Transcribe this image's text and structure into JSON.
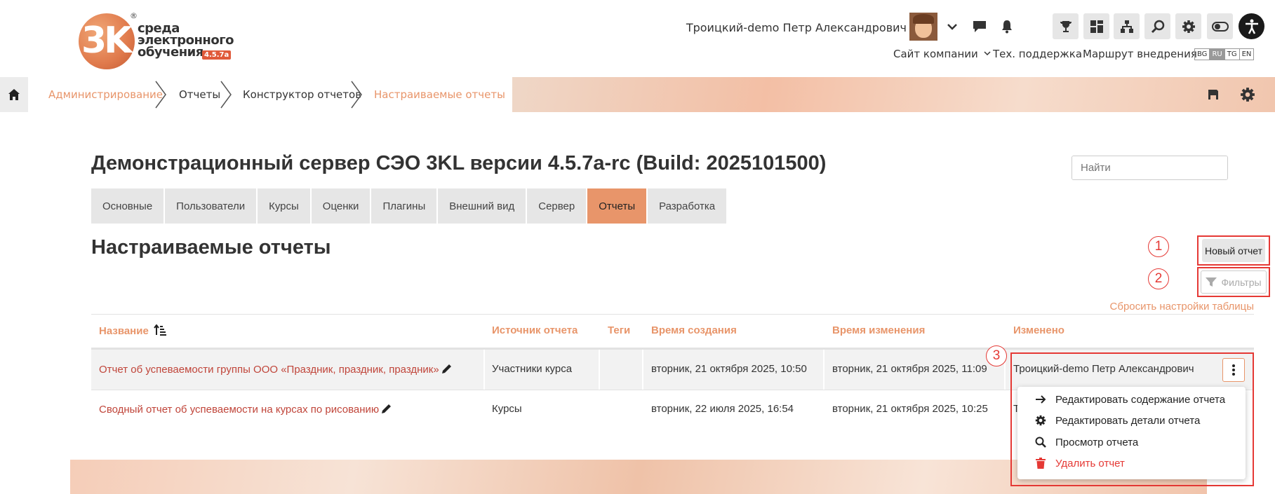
{
  "header": {
    "logo": {
      "line1": "среда",
      "line2": "электронного",
      "line3": "обучения",
      "version": "4.5.7a",
      "reg": "®"
    },
    "user_name": "Троицкий-demo Петр Александрович",
    "links": {
      "company": "Сайт компании",
      "support": "Тех. поддержка",
      "route": "Маршрут внедрения"
    },
    "languages": [
      {
        "code": "BG",
        "active": false
      },
      {
        "code": "RU",
        "active": true
      },
      {
        "code": "TG",
        "active": false
      },
      {
        "code": "EN",
        "active": false
      }
    ],
    "tool_icons": [
      "trophy-icon",
      "dashboard-icon",
      "sitemap-icon",
      "search-icon",
      "gear-icon",
      "toggle-icon"
    ]
  },
  "breadcrumb": {
    "items": [
      {
        "label": "Администрирование",
        "link": true
      },
      {
        "label": "Отчеты",
        "link": false
      },
      {
        "label": "Конструктор отчетов",
        "link": false
      },
      {
        "label": "Настраиваемые отчеты",
        "link": true
      }
    ]
  },
  "page": {
    "title": "Демонстрационный сервер СЭО 3KL версии 4.5.7a-rc (Build: 2025101500)",
    "search_placeholder": "Найти",
    "tabs": [
      {
        "label": "Основные",
        "active": false
      },
      {
        "label": "Пользователи",
        "active": false
      },
      {
        "label": "Курсы",
        "active": false
      },
      {
        "label": "Оценки",
        "active": false
      },
      {
        "label": "Плагины",
        "active": false
      },
      {
        "label": "Внешний вид",
        "active": false
      },
      {
        "label": "Сервер",
        "active": false
      },
      {
        "label": "Отчеты",
        "active": true
      },
      {
        "label": "Разработка",
        "active": false
      }
    ],
    "section_title": "Настраиваемые отчеты",
    "new_report_label": "Новый отчет",
    "filters_label": "Фильтры",
    "reset_label": "Сбросить настройки таблицы",
    "annotations": [
      "1",
      "2",
      "3"
    ]
  },
  "table": {
    "columns": [
      "Название",
      "Источник отчета",
      "Теги",
      "Время создания",
      "Время изменения",
      "Изменено"
    ],
    "rows": [
      {
        "name": "Отчет об успеваемости группы ООО «Праздник, праздник, праздник»",
        "source": "Участники курса",
        "tags": "",
        "created": "вторник, 21 октября 2025, 10:50",
        "modified": "вторник, 21 октября 2025, 11:09",
        "modified_by": "Троицкий-demo Петр Александрович"
      },
      {
        "name": "Сводный отчет об успеваемости на курсах по рисованию",
        "source": "Курсы",
        "tags": "",
        "created": "вторник, 22 июля 2025, 16:54",
        "modified": "вторник, 21 октября 2025, 10:25",
        "modified_by": "Т"
      }
    ]
  },
  "menu": {
    "items": [
      {
        "label": "Редактировать содержание отчета",
        "icon": "arrow-right-icon"
      },
      {
        "label": "Редактировать детали отчета",
        "icon": "gear-icon"
      },
      {
        "label": "Просмотр отчета",
        "icon": "search-icon"
      },
      {
        "label": "Удалить отчет",
        "icon": "trash-icon",
        "danger": true
      }
    ]
  },
  "colors": {
    "accent": "#e8956a",
    "link": "#c0453a",
    "annotation": "#e53935",
    "danger": "#e53935"
  }
}
